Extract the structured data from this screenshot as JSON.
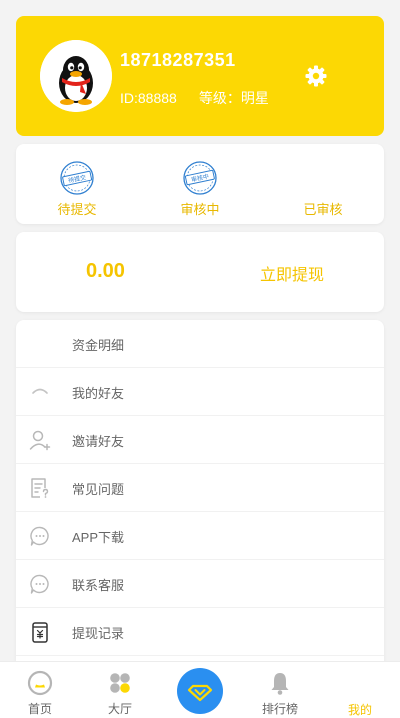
{
  "profile": {
    "phone": "18718287351",
    "id_text": "ID:88888",
    "level_text": "等级：明星"
  },
  "status": {
    "items": [
      {
        "label": "待提交",
        "stamp_text": "待提交"
      },
      {
        "label": "审核中",
        "stamp_text": "审核中"
      },
      {
        "label": "已审核"
      }
    ]
  },
  "wallet": {
    "balance": "0.00",
    "withdraw_label": "立即提现"
  },
  "menu": {
    "items": [
      {
        "label": "资金明细"
      },
      {
        "label": "我的好友"
      },
      {
        "label": "邀请好友"
      },
      {
        "label": "常见问题"
      },
      {
        "label": "APP下载"
      },
      {
        "label": "联系客服"
      },
      {
        "label": "提现记录"
      }
    ]
  },
  "tabbar": {
    "items": [
      {
        "label": "首页"
      },
      {
        "label": "大厅"
      },
      {
        "label": "排行榜"
      },
      {
        "label": "我的"
      }
    ]
  },
  "colors": {
    "accent": "#fcd804",
    "accent_text": "#f5c400",
    "center_button": "#2a8ff0",
    "stamp_blue": "#2f7fd0"
  },
  "icons": {
    "avatar": "qq-penguin-avatar",
    "settings": "gear-icon",
    "status_1": "stamp-pending-icon",
    "status_2": "stamp-reviewing-icon",
    "menu_2": "friends-icon",
    "menu_3": "invite-user-icon",
    "menu_4": "faq-icon",
    "menu_5": "download-chat-icon",
    "menu_6": "customer-service-icon",
    "menu_7": "withdraw-record-icon",
    "tab_1": "home-icon",
    "tab_2": "hall-icon",
    "tab_center": "diamond-icon",
    "tab_3": "bell-icon"
  }
}
